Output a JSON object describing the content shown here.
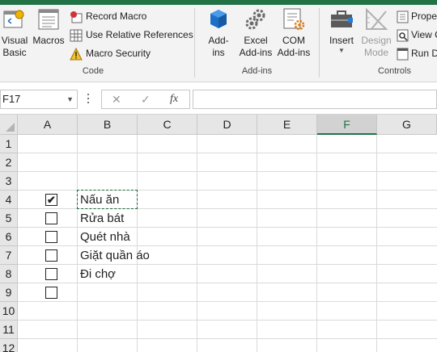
{
  "ribbon": {
    "code_group": {
      "label": "Code",
      "visual_basic": "Visual\nBasic",
      "macros": "Macros",
      "record_macro": "Record Macro",
      "relative_references": "Use Relative References",
      "macro_security": "Macro Security"
    },
    "addins_group": {
      "label": "Add-ins",
      "addins": "Add-\nins",
      "excel_addins": "Excel\nAdd-ins",
      "com_addins": "COM\nAdd-ins"
    },
    "controls_group": {
      "label": "Controls",
      "insert": "Insert",
      "design_mode": "Design\nMode",
      "properties": "Prope",
      "view_code": "View C",
      "run_dialog": "Run D"
    }
  },
  "formula_bar": {
    "name_box": "F17",
    "cancel_glyph": "✕",
    "enter_glyph": "✓",
    "fx_label": "fx",
    "formula": ""
  },
  "columns": [
    "A",
    "B",
    "C",
    "D",
    "E",
    "F",
    "G"
  ],
  "selected_column": "F",
  "rows": [
    "1",
    "2",
    "3",
    "4",
    "5",
    "6",
    "7",
    "8",
    "9",
    "10",
    "11",
    "12"
  ],
  "checklist": [
    {
      "row": 4,
      "checked": true,
      "text": "Nấu ăn"
    },
    {
      "row": 5,
      "checked": false,
      "text": "Rửa bát"
    },
    {
      "row": 6,
      "checked": false,
      "text": "Quét nhà"
    },
    {
      "row": 7,
      "checked": false,
      "text": "Giặt quần áo"
    },
    {
      "row": 8,
      "checked": false,
      "text": "Đi chợ"
    },
    {
      "row": 9,
      "checked": false,
      "text": ""
    }
  ],
  "colors": {
    "accent": "#217346",
    "marquee": "#1e6b3c",
    "header_bg": "#e6e6e6",
    "ribbon_bg": "#f3f3f3"
  }
}
